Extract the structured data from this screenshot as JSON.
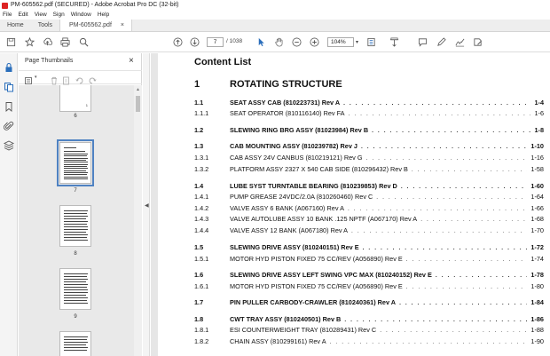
{
  "window": {
    "title": "PM-605562.pdf (SECURED) - Adobe Acrobat Pro DC (32-bit)"
  },
  "menu": [
    "File",
    "Edit",
    "View",
    "Sign",
    "Window",
    "Help"
  ],
  "tabs": {
    "home": "Home",
    "tools": "Tools",
    "document": "PM-605562.pdf",
    "close": "×"
  },
  "toolbar": {
    "page_current": "7",
    "page_total": "/ 1038",
    "zoom": "104%",
    "icons": [
      "save-icon",
      "bookmark-star-icon",
      "upload-icon",
      "print-icon",
      "search-icon",
      "prev-page-icon",
      "next-page-icon",
      "select-arrow-icon",
      "hand-icon",
      "zoom-out-icon",
      "zoom-in-icon",
      "fit-page-icon",
      "page-layout-icon",
      "scroll-mode-icon",
      "comment-icon",
      "pen-icon",
      "sign-icon",
      "fill-sign-icon"
    ]
  },
  "panel": {
    "title": "Page Thumbnails",
    "close": "×",
    "thumbnail_labels": [
      "6",
      "7",
      "8",
      "9"
    ],
    "partial_page_number": "1"
  },
  "document": {
    "heading": "Content List",
    "chapter": {
      "num": "1",
      "title": "ROTATING STRUCTURE"
    },
    "entries": [
      {
        "num": "1.1",
        "title": "SEAT ASSY CAB (810223731) Rev A",
        "page": "1-4",
        "bold": true
      },
      {
        "num": "1.1.1",
        "title": "SEAT OPERATOR (810116140) Rev FA",
        "page": "1-6",
        "bold": false
      },
      {
        "num": "1.2",
        "title": "SLEWING RING BRG ASSY (81023984) Rev B",
        "page": "1-8",
        "bold": true
      },
      {
        "num": "1.3",
        "title": "CAB MOUNTING ASSY (810239782) Rev J",
        "page": "1-10",
        "bold": true
      },
      {
        "num": "1.3.1",
        "title": "CAB ASSY 24V CANBUS (810219121) Rev G",
        "page": "1-16",
        "bold": false
      },
      {
        "num": "1.3.2",
        "title": "PLATFORM ASSY 2327 X 540 CAB SIDE (810296432) Rev B",
        "page": "1-58",
        "bold": false
      },
      {
        "num": "1.4",
        "title": "LUBE SYST TURNTABLE BEARING (810239853) Rev D",
        "page": "1-60",
        "bold": true
      },
      {
        "num": "1.4.1",
        "title": "PUMP GREASE 24VDC/2.0A (810260460) Rev C",
        "page": "1-64",
        "bold": false
      },
      {
        "num": "1.4.2",
        "title": "VALVE ASSY 6 BANK (A067160) Rev A",
        "page": "1-66",
        "bold": false
      },
      {
        "num": "1.4.3",
        "title": "VALVE AUTOLUBE ASSY 10 BANK .125 NPTF (A067170) Rev A",
        "page": "1-68",
        "bold": false
      },
      {
        "num": "1.4.4",
        "title": "VALVE ASSY 12 BANK (A067180) Rev A",
        "page": "1-70",
        "bold": false
      },
      {
        "num": "1.5",
        "title": "SLEWING DRIVE ASSY (810240151) Rev E",
        "page": "1-72",
        "bold": true
      },
      {
        "num": "1.5.1",
        "title": "MOTOR HYD PISTON FIXED 75 CC/REV (A056890) Rev E",
        "page": "1-74",
        "bold": false
      },
      {
        "num": "1.6",
        "title": "SLEWING DRIVE ASSY LEFT SWING VPC MAX (810240152) Rev E",
        "page": "1-78",
        "bold": true
      },
      {
        "num": "1.6.1",
        "title": "MOTOR HYD PISTON FIXED 75 CC/REV (A056890) Rev E",
        "page": "1-80",
        "bold": false
      },
      {
        "num": "1.7",
        "title": "PIN PULLER CARBODY-CRAWLER (810240361) Rev A",
        "page": "1-84",
        "bold": true
      },
      {
        "num": "1.8",
        "title": "CWT TRAY ASSY (810240501) Rev B",
        "page": "1-86",
        "bold": true
      },
      {
        "num": "1.8.1",
        "title": "ESI COUNTERWEIGHT TRAY (810289431) Rev C",
        "page": "1-88",
        "bold": false
      },
      {
        "num": "1.8.2",
        "title": "CHAIN ASSY (810299161) Rev A",
        "page": "1-90",
        "bold": false
      }
    ]
  }
}
